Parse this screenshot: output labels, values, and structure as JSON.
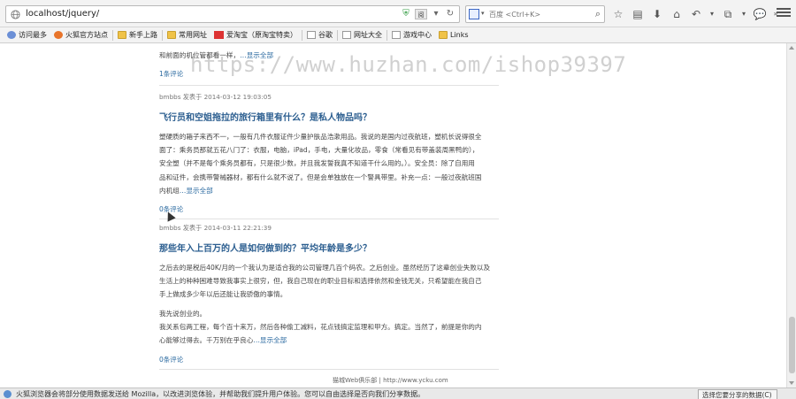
{
  "browser": {
    "url": "localhost/jquery/",
    "search_placeholder": "百度 <Ctrl+K>",
    "bookmarks": [
      {
        "label": "访问最多",
        "icon": "gear"
      },
      {
        "label": "火狐官方站点",
        "icon": "fox"
      },
      {
        "label": "新手上路",
        "icon": "folder"
      },
      {
        "label": "常用网址",
        "icon": "folder"
      },
      {
        "label": "爱淘宝（原淘宝特卖）",
        "icon": "red"
      },
      {
        "label": "谷歌",
        "icon": "page"
      },
      {
        "label": "网址大全",
        "icon": "page"
      },
      {
        "label": "游戏中心",
        "icon": "page"
      },
      {
        "label": "Links",
        "icon": "folder"
      }
    ]
  },
  "watermark": "https://www.huzhan.com/ishop39397",
  "posts": [
    {
      "excerpt_lines": [
        "和前面的机位管都看一样，"
      ],
      "more": "显示全部",
      "comments": "1条评论"
    },
    {
      "meta": "bmbbs 发表于 2014-03-12 19:03:05",
      "title": "飞行员和空姐拖拉的旅行箱里有什么？是私人物品吗？",
      "excerpt_lines": [
        "塑硬质的箱子来西不一，一般有几件衣服证件少量护肤品浩漱用品。我说的是国内过夜航班，塑机长说得很全",
        "面了：乘务员那就五花八门了：衣服，电脑，iPad，手电，大量化妆品，零食（常看见有带盖装周黑鸭的），",
        "安全塑（并不是每个乘务员都有，只是很少数，并且我发誓我真不知道干什么用的。）。安全员：除了自用用",
        "品和证件，会携带警械器材，都有什么就不说了。但是会单独放在一个警具带里。补充一点：一般过夜航班国",
        "内机组"
      ],
      "more": "显示全部",
      "comments": "0条评论"
    },
    {
      "meta": "bmbbs 发表于 2014-03-11 22:21:39",
      "title": "那些年入上百万的人是如何做到的？平均年龄是多少？",
      "excerpt_lines": [
        "之后去的是税后40K/月的一个我认为是适合我的公司管理几百个码农。之后创业。虽然经历了这辈创业失败以及",
        "生活上的种种困难导致我事实上很穷，但，我自己现在的职业目标和选择依然和金钱无关，只希望能在我自己",
        "手上做成多少年以后还能让我骄傲的事情。"
      ],
      "excerpt2_lines": [
        "我先说创业的。",
        "我关系包两工程，每个百十来万，然后各种偷工减料，花点钱搞定监理和甲方。搞定。当然了，前提是你的内",
        "心能够过得去。千万别在乎良心"
      ],
      "more": "显示全部",
      "comments": "0条评论"
    }
  ],
  "footer": "猫城Web俱乐部 | http://www.ycku.com",
  "notification": {
    "text": "火狐浏览器会将部分使用数据发送给 Mozilla，以改进浏览体验，并帮助我们提升用户体验。您可以自由选择是否向我们分享数据。",
    "button": "选择您要分享的数据(C)"
  }
}
